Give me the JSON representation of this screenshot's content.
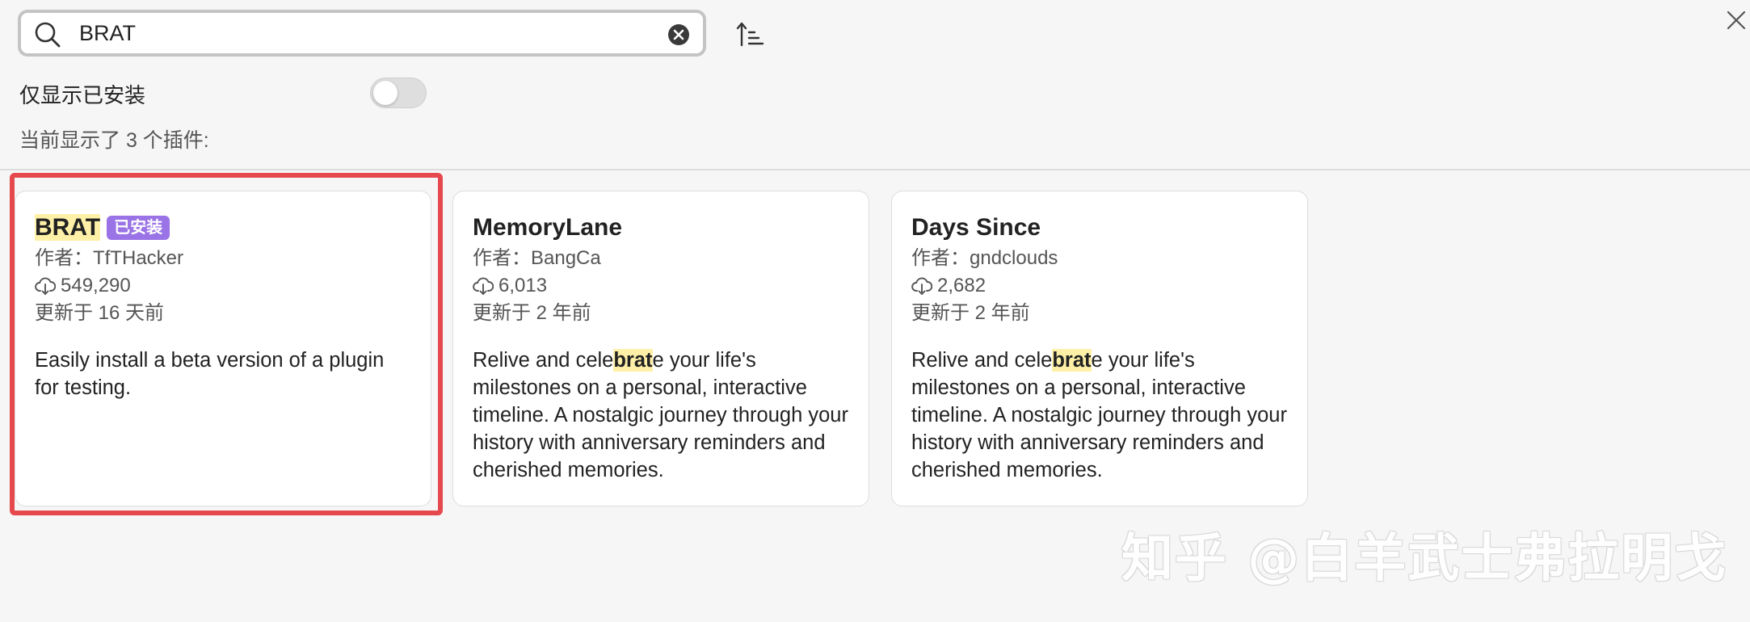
{
  "search": {
    "value": "BRAT",
    "icon": "search-icon",
    "clear_icon": "clear-icon"
  },
  "toolbar": {
    "sort_icon": "sort-ascending-icon",
    "close_icon": "close-icon"
  },
  "filter": {
    "installed_only_label": "仅显示已安装",
    "installed_only_enabled": false
  },
  "results": {
    "count_text": "当前显示了 3 个插件:"
  },
  "plugins": [
    {
      "title_highlight": "BRAT",
      "title_rest": "",
      "badge": "已安装",
      "author": "作者：TfTHacker",
      "downloads": "549,290",
      "updated": "更新于 16 天前",
      "desc_before": "Easily install a beta version of a plugin for testing.",
      "desc_highlight": "",
      "desc_after": "",
      "selected": true
    },
    {
      "title_highlight": "",
      "title_rest": "MemoryLane",
      "badge": "",
      "author": "作者：BangCa",
      "downloads": "6,013",
      "updated": "更新于 2 年前",
      "desc_before": "Relive and cele",
      "desc_highlight": "brat",
      "desc_after": "e your life's milestones on a personal, interactive timeline. A nostalgic journey through your history with anniversary reminders and cherished memories.",
      "selected": false
    },
    {
      "title_highlight": "",
      "title_rest": "Days Since",
      "badge": "",
      "author": "作者：gndclouds",
      "downloads": "2,682",
      "updated": "更新于 2 年前",
      "desc_before": "Relive and cele",
      "desc_highlight": "brat",
      "desc_after": "e your life's milestones on a personal, interactive timeline. A nostalgic journey through your history with anniversary reminders and cherished memories.",
      "selected": false
    }
  ],
  "colors": {
    "background": "#f6f6f6",
    "card_background": "#ffffff",
    "highlight": "#fff0a8",
    "badge": "#9a73e6",
    "selection_frame": "#e5484d"
  },
  "watermark": "知乎 @白羊武士弗拉明戈"
}
